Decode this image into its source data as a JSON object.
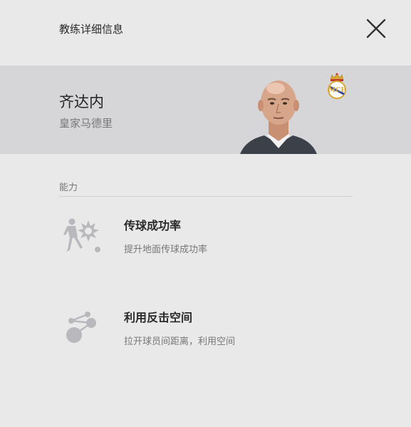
{
  "dialog": {
    "title": "教练详细信息"
  },
  "coach": {
    "name": "齐达内",
    "club": "皇家马德里"
  },
  "abilities_section": {
    "label": "能力",
    "items": [
      {
        "title": "传球成功率",
        "description": "提升地面传球成功率",
        "icon": "player-passing-icon"
      },
      {
        "title": "利用反击空间",
        "description": "拉开球员间距离，利用空间",
        "icon": "counter-attack-space-icon"
      }
    ]
  },
  "colors": {
    "background": "#e9e9ea",
    "coach_band": "#d6d6d8",
    "icon_gray": "#b9b9bd"
  }
}
